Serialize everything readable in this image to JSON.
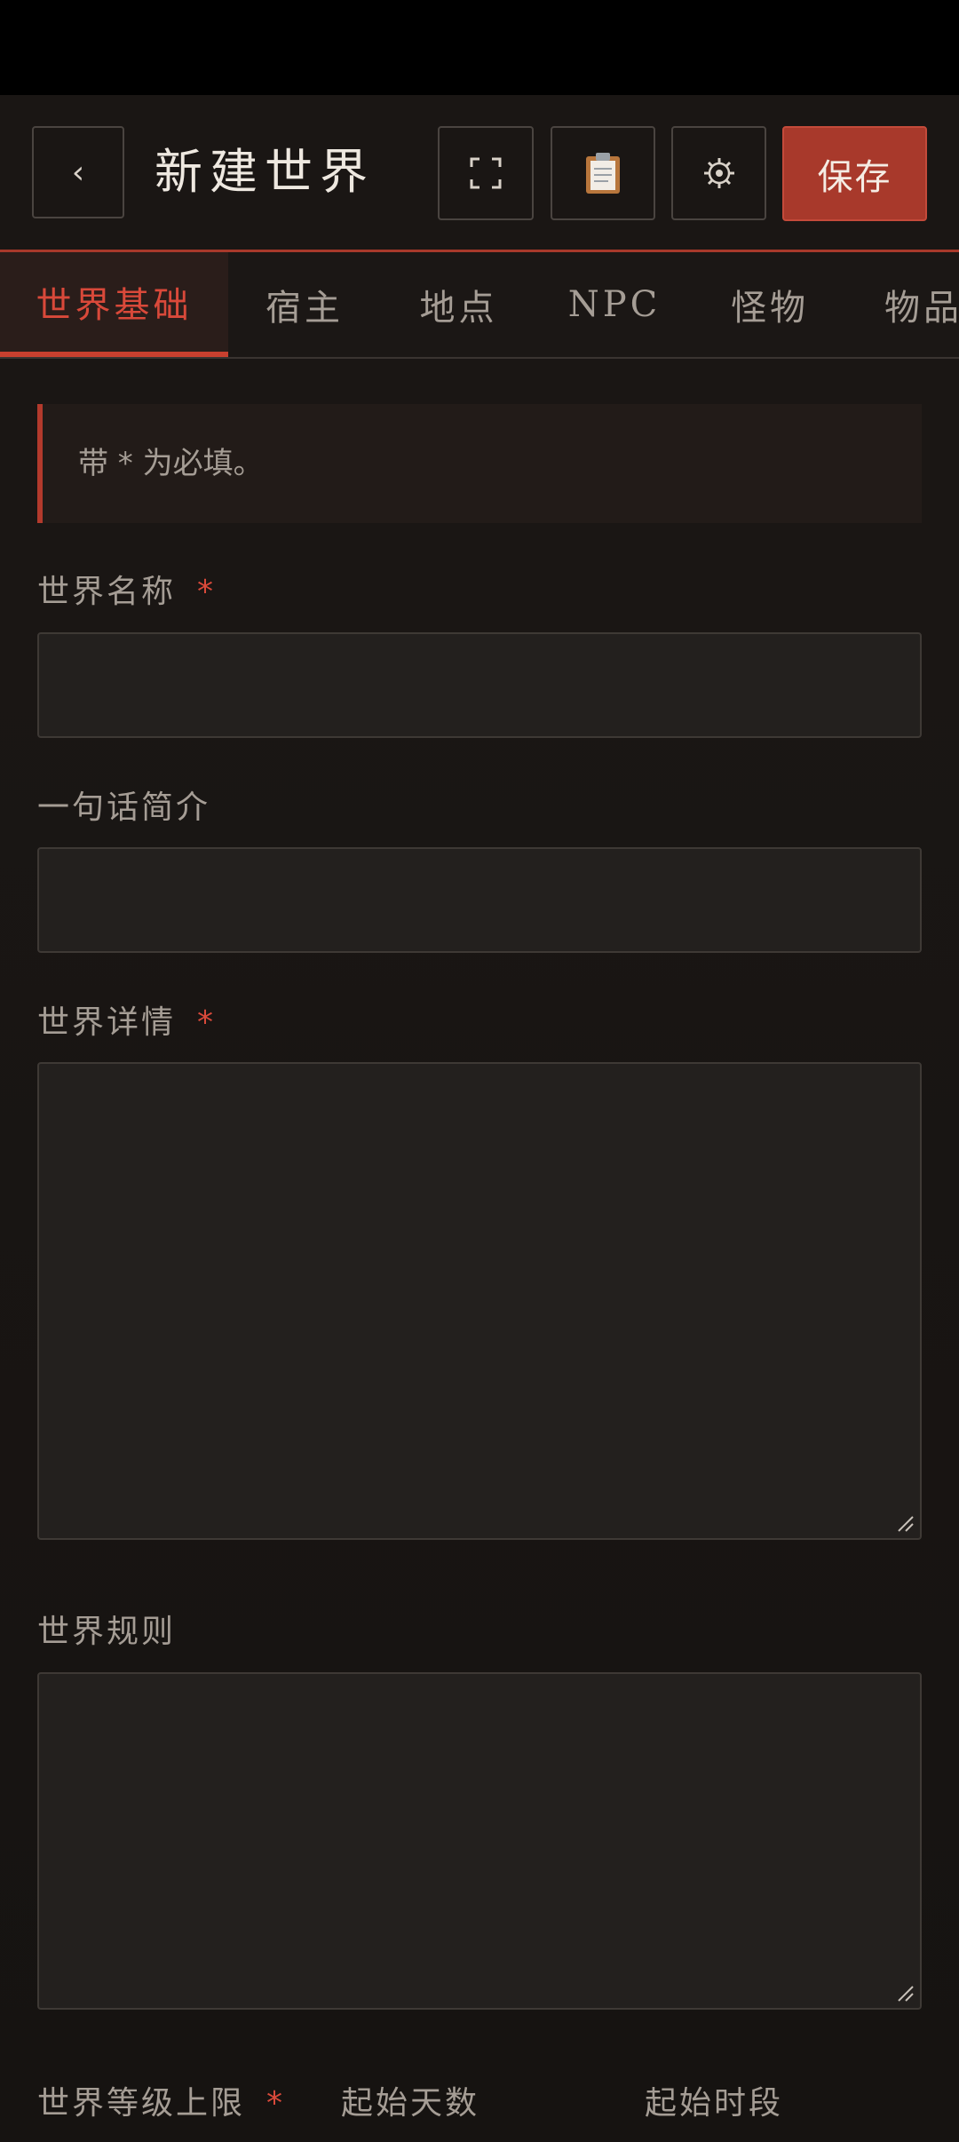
{
  "header": {
    "back_label": "‹",
    "title": "新建世界",
    "save_label": "保存",
    "icons": [
      "fullscreen-icon",
      "clipboard-icon",
      "gear-icon"
    ]
  },
  "tabs": [
    {
      "label": "世界基础",
      "active": true
    },
    {
      "label": "宿主",
      "active": false
    },
    {
      "label": "地点",
      "active": false
    },
    {
      "label": "NPC",
      "active": false
    },
    {
      "label": "怪物",
      "active": false
    },
    {
      "label": "物品",
      "active": false
    }
  ],
  "notice": "带 * 为必填。",
  "form": {
    "world_name": {
      "label": "世界名称",
      "required": "*",
      "value": ""
    },
    "tagline": {
      "label": "一句话简介",
      "value": ""
    },
    "world_details": {
      "label": "世界详情",
      "required": "*",
      "value": ""
    },
    "world_rules": {
      "label": "世界规则",
      "value": ""
    },
    "level_cap": {
      "label": "世界等级上限",
      "required": "*"
    },
    "start_day": {
      "label": "起始天数"
    },
    "start_period": {
      "label": "起始时段"
    }
  },
  "colors": {
    "accent": "#a8392b",
    "active_tab_text": "#d9493a",
    "background": "#1b1715"
  }
}
